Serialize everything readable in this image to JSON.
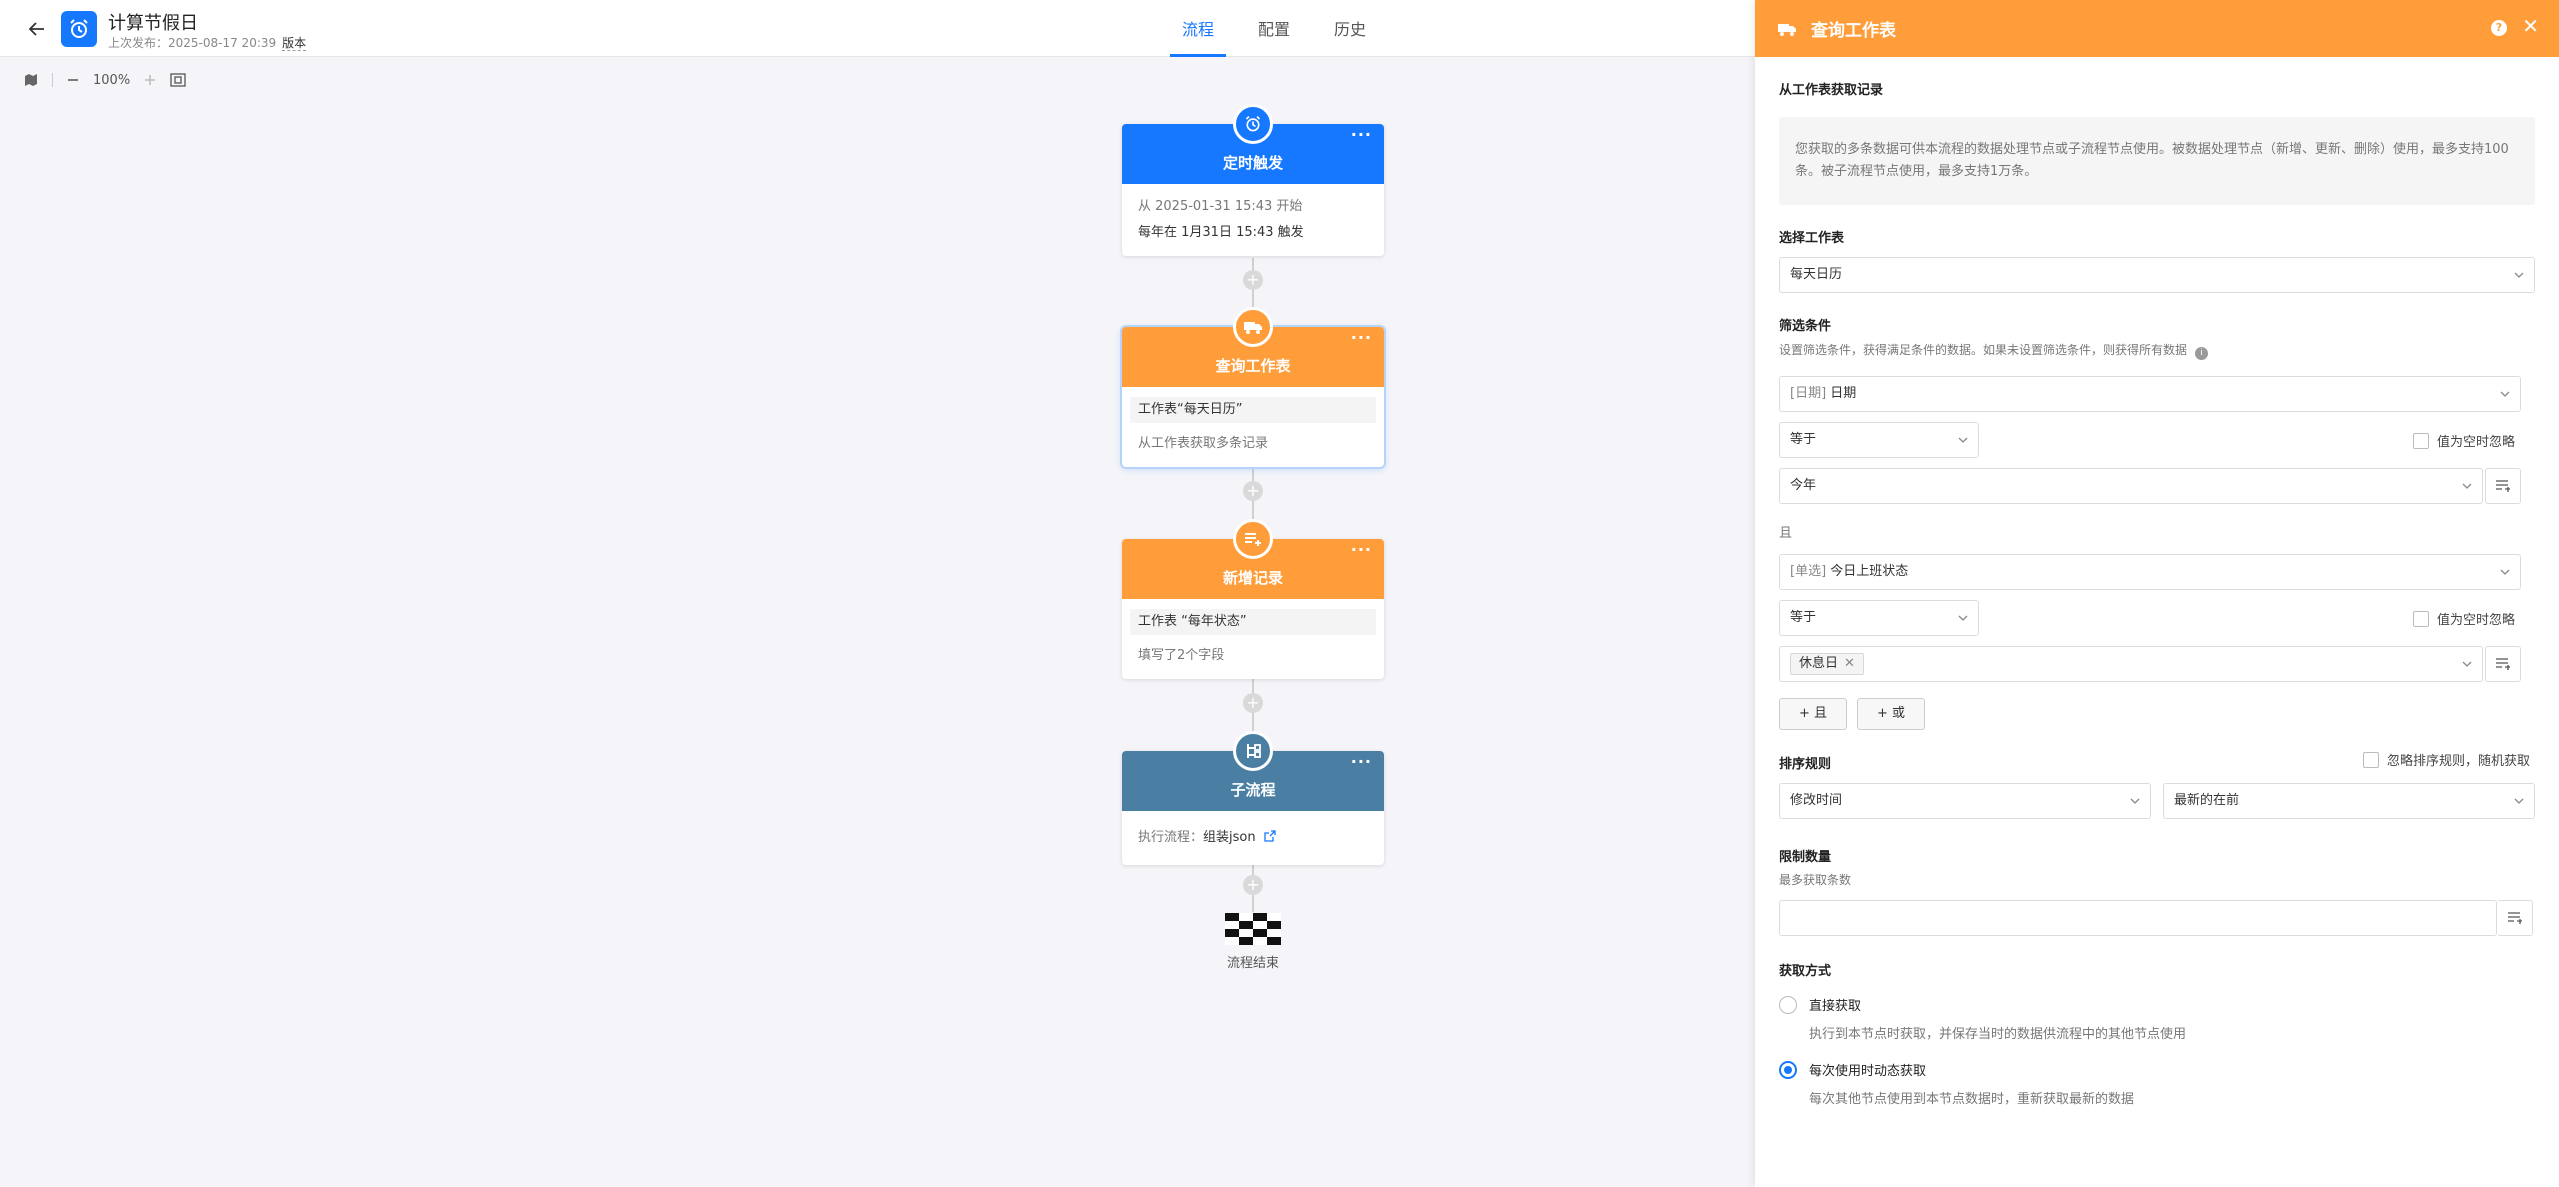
{
  "header": {
    "title": "计算节假日",
    "sub_prefix": "上次发布：2025-08-17 20:39",
    "version_label": "版本",
    "tabs": [
      {
        "label": "流程",
        "active": true
      },
      {
        "label": "配置",
        "active": false
      },
      {
        "label": "历史",
        "active": false
      }
    ]
  },
  "toolbar": {
    "zoom": "100%"
  },
  "colors": {
    "primary": "#1677ff",
    "orange": "#ff9d3a",
    "subflow": "#4a7fa3"
  },
  "nodes": {
    "timer": {
      "title": "定时触发",
      "line1": "从 2025-01-31 15:43 开始",
      "line2": "每年在 1月31日 15:43 触发",
      "icon": "alarm-clock-icon"
    },
    "query": {
      "title": "查询工作表",
      "line1": "工作表“每天日历”",
      "line2": "从工作表获取多条记录",
      "icon": "truck-icon"
    },
    "add": {
      "title": "新增记录",
      "line1": "工作表 “每年状态”",
      "line2": "填写了2个字段",
      "icon": "list-add-icon"
    },
    "subflow": {
      "title": "子流程",
      "line_prefix": "执行流程：",
      "line_value": "组装json",
      "icon": "subflow-icon"
    },
    "end": {
      "label": "流程结束"
    }
  },
  "panel": {
    "title": "查询工作表",
    "subtitle": "从工作表获取记录",
    "info": "您获取的多条数据可供本流程的数据处理节点或子流程节点使用。被数据处理节点（新增、更新、删除）使用，最多支持100条。被子流程节点使用，最多支持1万条。",
    "select_sheet_label": "选择工作表",
    "select_sheet_value": "每天日历",
    "filter_label": "筛选条件",
    "filter_desc": "设置筛选条件，获得满足条件的数据。如果未设置筛选条件，则获得所有数据",
    "cond1": {
      "field_prefix": "[日期]",
      "field": "日期",
      "op": "等于",
      "ignore_empty": "值为空时忽略",
      "value": "今年"
    },
    "and_label": "且",
    "cond2": {
      "field_prefix": "[单选]",
      "field": "今日上班状态",
      "op": "等于",
      "ignore_empty": "值为空时忽略",
      "tag": "休息日"
    },
    "add_and": "+ 且",
    "add_or": "+ 或",
    "sort_label": "排序规则",
    "sort_ignore": "忽略排序规则，随机获取",
    "sort_field": "修改时间",
    "sort_order": "最新的在前",
    "limit_label": "限制数量",
    "limit_desc": "最多获取条数",
    "fetch_label": "获取方式",
    "fetch_direct": "直接获取",
    "fetch_direct_desc": "执行到本节点时获取，并保存当时的数据供流程中的其他节点使用",
    "fetch_dynamic": "每次使用时动态获取",
    "fetch_dynamic_desc": "每次其他节点使用到本节点数据时，重新获取最新的数据"
  }
}
